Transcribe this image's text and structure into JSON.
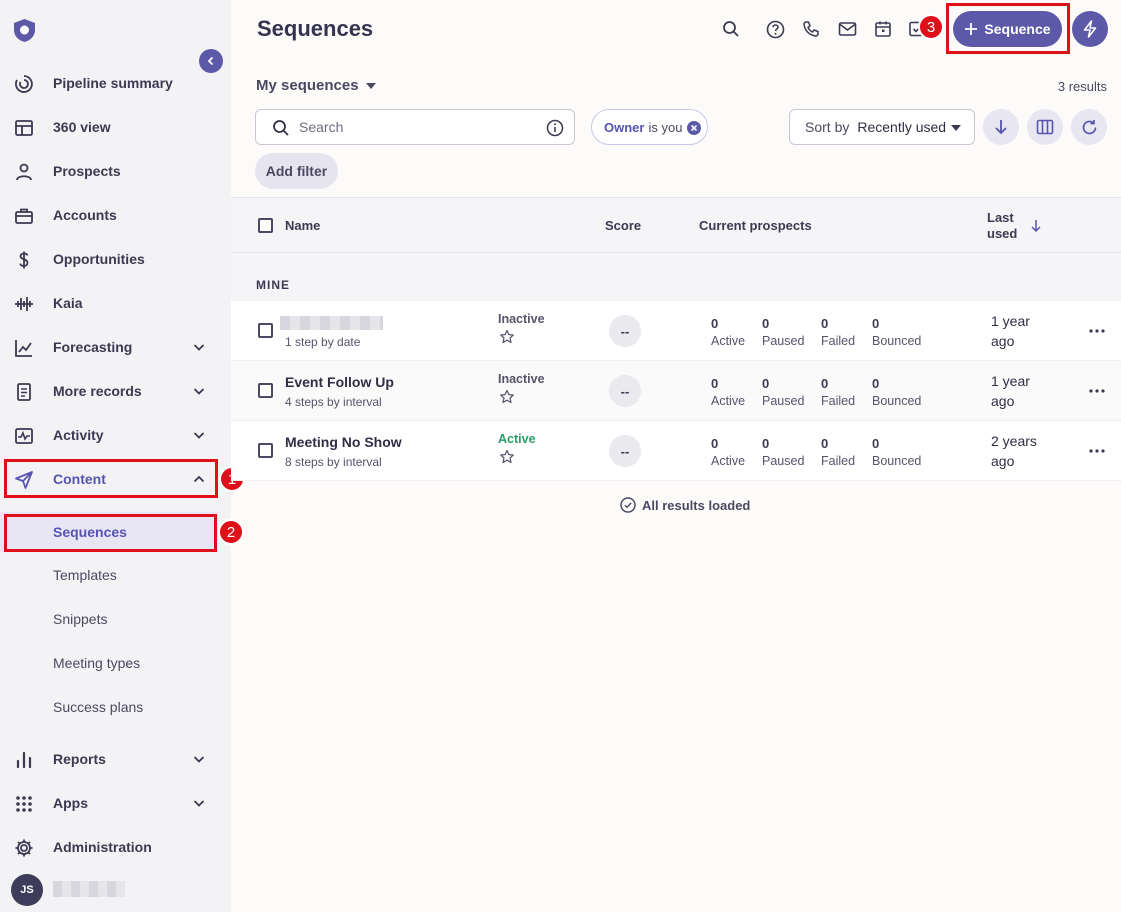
{
  "sidebar": {
    "items": {
      "pipeline": "Pipeline summary",
      "view360": "360 view",
      "prospects": "Prospects",
      "accounts": "Accounts",
      "opportunities": "Opportunities",
      "kaia": "Kaia",
      "forecasting": "Forecasting",
      "more_records": "More records",
      "activity": "Activity",
      "content": "Content",
      "reports": "Reports",
      "apps": "Apps",
      "administration": "Administration"
    },
    "content_sub": {
      "sequences": "Sequences",
      "templates": "Templates",
      "snippets": "Snippets",
      "meeting_types": "Meeting types",
      "success_plans": "Success plans"
    },
    "user_initials": "JS",
    "accent": "#5654b0"
  },
  "header": {
    "title": "Sequences",
    "new_button": "Sequence"
  },
  "annotations": {
    "n1": "1",
    "n2": "2",
    "n3": "3"
  },
  "toolbar": {
    "view_name": "My sequences",
    "results": "3 results",
    "search_placeholder": "Search",
    "chip_key": "Owner",
    "chip_value": "is you",
    "sort_label": "Sort by",
    "sort_value": "Recently used",
    "add_filter": "Add filter"
  },
  "table": {
    "headers": {
      "name": "Name",
      "score": "Score",
      "current": "Current prospects",
      "last_used_1": "Last",
      "last_used_2": "used"
    },
    "group": "MINE",
    "metric_labels": {
      "active": "Active",
      "paused": "Paused",
      "failed": "Failed",
      "bounced": "Bounced"
    },
    "rows": [
      {
        "name": "",
        "sub": "1 step by date",
        "status": "Inactive",
        "score": "--",
        "active": "0",
        "paused": "0",
        "failed": "0",
        "bounced": "0",
        "last1": "1 year",
        "last2": "ago"
      },
      {
        "name": "Event Follow Up",
        "sub": "4 steps by interval",
        "status": "Inactive",
        "score": "--",
        "active": "0",
        "paused": "0",
        "failed": "0",
        "bounced": "0",
        "last1": "1 year",
        "last2": "ago"
      },
      {
        "name": "Meeting No Show",
        "sub": "8 steps by interval",
        "status": "Active",
        "score": "--",
        "active": "0",
        "paused": "0",
        "failed": "0",
        "bounced": "0",
        "last1": "2 years",
        "last2": "ago"
      }
    ],
    "footer": "All results loaded"
  }
}
